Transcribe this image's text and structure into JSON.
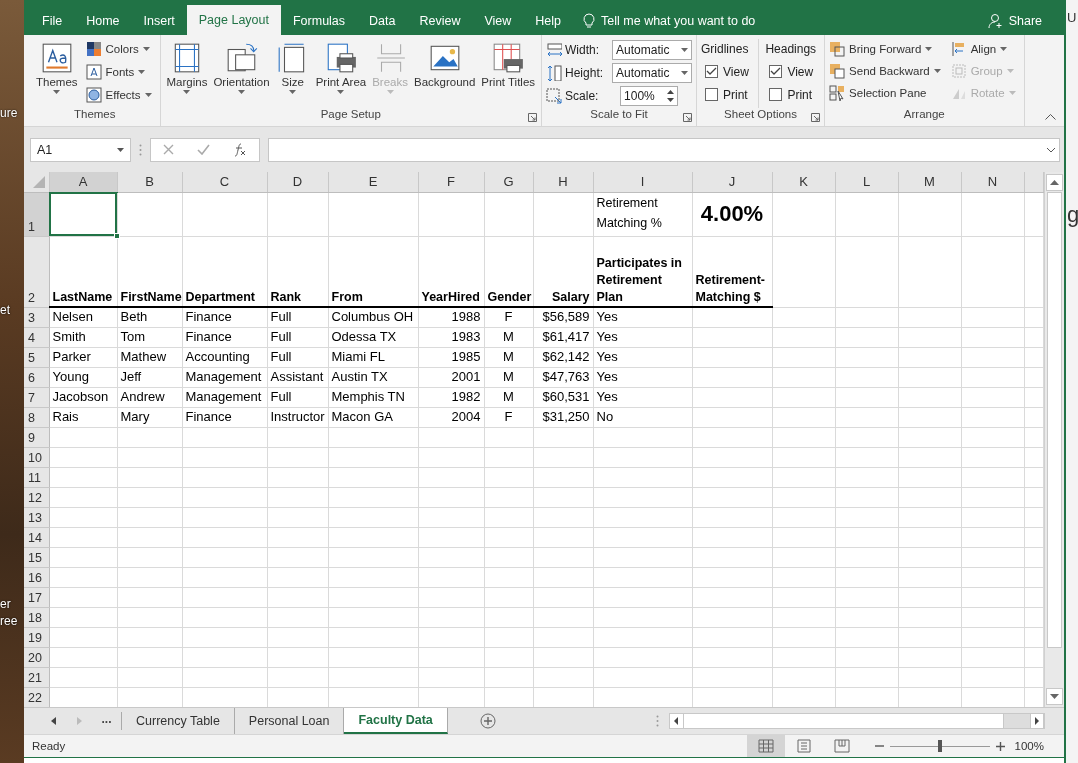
{
  "desktop": {
    "left_labels": [
      "ure",
      "et",
      "er",
      "ree"
    ],
    "right_labels": [
      "U",
      "g"
    ]
  },
  "ribbon_tabs": [
    {
      "label": "File",
      "selected": false
    },
    {
      "label": "Home",
      "selected": false
    },
    {
      "label": "Insert",
      "selected": false
    },
    {
      "label": "Page Layout",
      "selected": true
    },
    {
      "label": "Formulas",
      "selected": false
    },
    {
      "label": "Data",
      "selected": false
    },
    {
      "label": "Review",
      "selected": false
    },
    {
      "label": "View",
      "selected": false
    },
    {
      "label": "Help",
      "selected": false
    }
  ],
  "tell_me": "Tell me what you want to do",
  "share": "Share",
  "ribbon_groups": [
    {
      "title": "Themes",
      "launcher": false,
      "columns": [
        [
          {
            "kind": "large",
            "label": "Themes",
            "dropdown": true,
            "disabled": false
          }
        ],
        [
          {
            "kind": "small",
            "label": "Colors",
            "dropdown": true,
            "disabled": false
          },
          {
            "kind": "small",
            "label": "Fonts",
            "dropdown": true,
            "disabled": false
          },
          {
            "kind": "small",
            "label": "Effects",
            "dropdown": true,
            "disabled": false
          }
        ]
      ]
    },
    {
      "title": "Page Setup",
      "launcher": true,
      "columns": [
        [
          {
            "kind": "large",
            "label": "Margins",
            "dropdown": true,
            "disabled": false
          }
        ],
        [
          {
            "kind": "large",
            "label": "Orientation",
            "dropdown": true,
            "disabled": false
          }
        ],
        [
          {
            "kind": "large",
            "label": "Size",
            "dropdown": true,
            "disabled": false
          }
        ],
        [
          {
            "kind": "large",
            "label": "Print Area",
            "dropdown": true,
            "disabled": false
          }
        ],
        [
          {
            "kind": "large",
            "label": "Breaks",
            "dropdown": true,
            "disabled": true
          }
        ],
        [
          {
            "kind": "large",
            "label": "Background",
            "dropdown": false,
            "disabled": false
          }
        ],
        [
          {
            "kind": "large",
            "label": "Print Titles",
            "dropdown": false,
            "disabled": false
          }
        ]
      ]
    },
    {
      "title": "Scale to Fit",
      "launcher": true,
      "columns": [
        [
          {
            "kind": "select",
            "label": "Width:",
            "value": "Automatic"
          },
          {
            "kind": "select",
            "label": "Height:",
            "value": "Automatic"
          },
          {
            "kind": "spin",
            "label": "Scale:",
            "value": "100%"
          }
        ]
      ]
    },
    {
      "title": "Sheet Options",
      "launcher": true,
      "columns": [
        [
          {
            "kind": "heading",
            "label": "Gridlines"
          },
          {
            "kind": "check",
            "label": "View",
            "checked": true
          },
          {
            "kind": "check",
            "label": "Print",
            "checked": false
          }
        ],
        [
          {
            "kind": "heading",
            "label": "Headings"
          },
          {
            "kind": "check",
            "label": "View",
            "checked": true
          },
          {
            "kind": "check",
            "label": "Print",
            "checked": false
          }
        ]
      ]
    },
    {
      "title": "Arrange",
      "launcher": false,
      "columns": [
        [
          {
            "kind": "small",
            "label": "Bring Forward",
            "dropdown": true,
            "disabled": false
          },
          {
            "kind": "small",
            "label": "Send Backward",
            "dropdown": true,
            "disabled": false
          },
          {
            "kind": "small",
            "label": "Selection Pane",
            "dropdown": false,
            "disabled": false
          }
        ],
        [
          {
            "kind": "small",
            "label": "Align",
            "dropdown": true,
            "disabled": false
          },
          {
            "kind": "small",
            "label": "Group",
            "dropdown": true,
            "disabled": true
          },
          {
            "kind": "small",
            "label": "Rotate",
            "dropdown": true,
            "disabled": true
          }
        ]
      ]
    }
  ],
  "name_box": "A1",
  "columns": [
    {
      "label": "A",
      "selected": true
    },
    {
      "label": "B",
      "selected": false
    },
    {
      "label": "C",
      "selected": false
    },
    {
      "label": "D",
      "selected": false
    },
    {
      "label": "E",
      "selected": false
    },
    {
      "label": "F",
      "selected": false
    },
    {
      "label": "G",
      "selected": false
    },
    {
      "label": "H",
      "selected": false
    },
    {
      "label": "I",
      "selected": false
    },
    {
      "label": "J",
      "selected": false
    },
    {
      "label": "K",
      "selected": false
    },
    {
      "label": "L",
      "selected": false
    },
    {
      "label": "M",
      "selected": false
    },
    {
      "label": "N",
      "selected": false
    }
  ],
  "rows": [
    {
      "number": "1",
      "selected": true,
      "kind": "note",
      "cells": [
        null,
        null,
        null,
        null,
        null,
        null,
        null,
        null,
        "Retirement Matching %",
        "4.00%"
      ]
    },
    {
      "number": "2",
      "selected": false,
      "kind": "header",
      "cells": [
        "LastName",
        "FirstName",
        "Department",
        "Rank",
        "From",
        "YearHired",
        "Gender",
        "Salary",
        "Participates in Retirement Plan",
        "Retirement-Matching $"
      ]
    },
    {
      "number": "3",
      "selected": false,
      "kind": "data",
      "cells": [
        "Nelsen",
        "Beth",
        "Finance",
        "Full",
        "Columbus OH",
        "1988",
        "F",
        "$56,589",
        "Yes"
      ]
    },
    {
      "number": "4",
      "selected": false,
      "kind": "data",
      "cells": [
        "Smith",
        "Tom",
        "Finance",
        "Full",
        "Odessa TX",
        "1983",
        "M",
        "$61,417",
        "Yes"
      ]
    },
    {
      "number": "5",
      "selected": false,
      "kind": "data",
      "cells": [
        "Parker",
        "Mathew",
        "Accounting",
        "Full",
        "Miami FL",
        "1985",
        "M",
        "$62,142",
        "Yes"
      ]
    },
    {
      "number": "6",
      "selected": false,
      "kind": "data",
      "cells": [
        "Young",
        "Jeff",
        "Management",
        "Assistant",
        "Austin TX",
        "2001",
        "M",
        "$47,763",
        "Yes"
      ]
    },
    {
      "number": "7",
      "selected": false,
      "kind": "data",
      "cells": [
        "Jacobson",
        "Andrew",
        "Management",
        "Full",
        "Memphis TN",
        "1982",
        "M",
        "$60,531",
        "Yes"
      ]
    },
    {
      "number": "8",
      "selected": false,
      "kind": "data",
      "cells": [
        "Rais",
        "Mary",
        "Finance",
        "Instructor",
        "Macon GA",
        "2004",
        "F",
        "$31,250",
        "No"
      ]
    },
    {
      "number": "9",
      "selected": false,
      "kind": "data"
    },
    {
      "number": "10",
      "selected": false,
      "kind": "data"
    },
    {
      "number": "11",
      "selected": false,
      "kind": "data"
    },
    {
      "number": "12",
      "selected": false,
      "kind": "data"
    },
    {
      "number": "13",
      "selected": false,
      "kind": "data"
    },
    {
      "number": "14",
      "selected": false,
      "kind": "data"
    },
    {
      "number": "15",
      "selected": false,
      "kind": "data"
    },
    {
      "number": "16",
      "selected": false,
      "kind": "data"
    },
    {
      "number": "17",
      "selected": false,
      "kind": "data"
    },
    {
      "number": "18",
      "selected": false,
      "kind": "data"
    },
    {
      "number": "19",
      "selected": false,
      "kind": "data"
    },
    {
      "number": "20",
      "selected": false,
      "kind": "data"
    },
    {
      "number": "21",
      "selected": false,
      "kind": "data"
    },
    {
      "number": "22",
      "selected": false,
      "kind": "data"
    }
  ],
  "sheet_overflow": "...",
  "sheet_tabs": [
    {
      "label": "Currency Table",
      "selected": false
    },
    {
      "label": "Personal Loan",
      "selected": false
    },
    {
      "label": "Faculty Data",
      "selected": true
    }
  ],
  "status": "Ready",
  "view_buttons": [
    {
      "selected": true
    },
    {
      "selected": false
    },
    {
      "selected": false
    }
  ],
  "zoom": {
    "level": 0.5,
    "reading": "100%"
  }
}
